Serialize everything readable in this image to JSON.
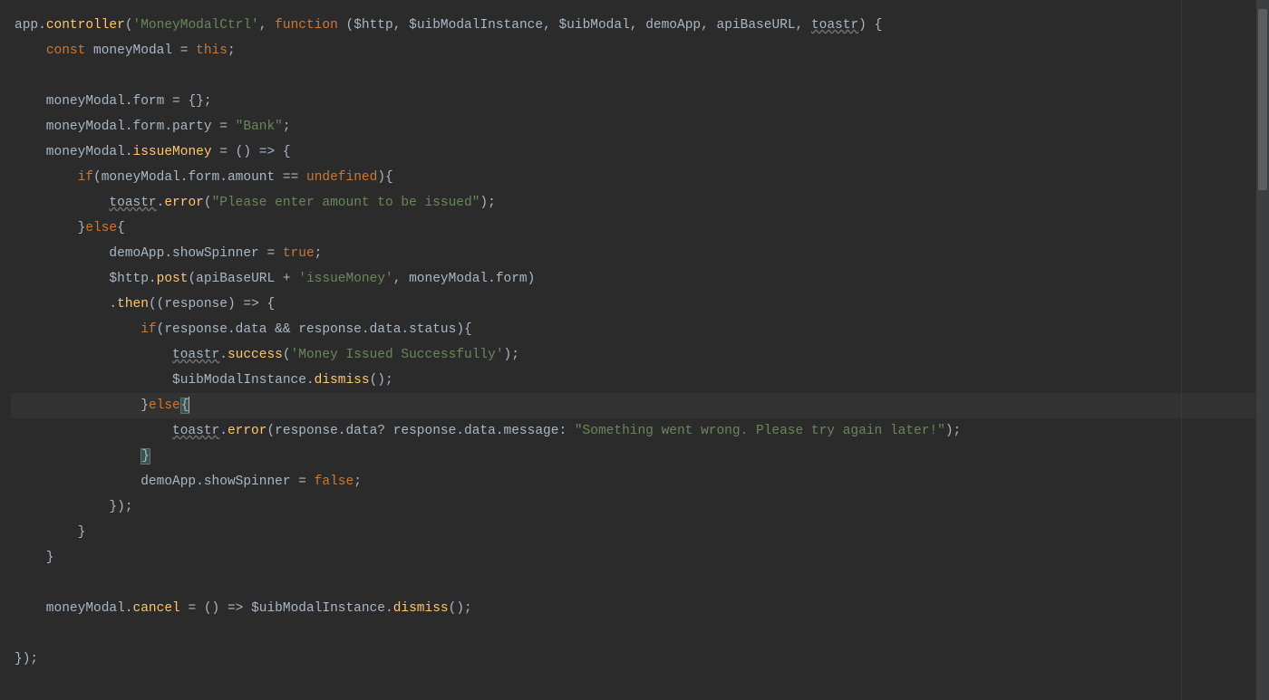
{
  "editor": {
    "lang": "javascript",
    "current_line_index": 15,
    "tokens_per_line": [
      [
        {
          "t": "app",
          "c": "c-default"
        },
        {
          "t": ".",
          "c": "c-default"
        },
        {
          "t": "controller",
          "c": "c-func"
        },
        {
          "t": "(",
          "c": "c-default"
        },
        {
          "t": "'MoneyModalCtrl'",
          "c": "c-string"
        },
        {
          "t": ", ",
          "c": "c-default"
        },
        {
          "t": "function",
          "c": "c-keyword"
        },
        {
          "t": " (",
          "c": "c-default"
        },
        {
          "t": "$http",
          "c": "c-default"
        },
        {
          "t": ", ",
          "c": "c-default"
        },
        {
          "t": "$uibModalInstance",
          "c": "c-default"
        },
        {
          "t": ", ",
          "c": "c-default"
        },
        {
          "t": "$uibModal",
          "c": "c-default"
        },
        {
          "t": ", ",
          "c": "c-default"
        },
        {
          "t": "demoApp",
          "c": "c-default"
        },
        {
          "t": ", ",
          "c": "c-default"
        },
        {
          "t": "apiBaseURL",
          "c": "c-default"
        },
        {
          "t": ", ",
          "c": "c-default"
        },
        {
          "t": "toastr",
          "c": "c-default underline-squiggle"
        },
        {
          "t": ") {",
          "c": "c-default"
        }
      ],
      [
        {
          "t": "    ",
          "c": "c-default"
        },
        {
          "t": "const",
          "c": "c-keyword"
        },
        {
          "t": " moneyModal = ",
          "c": "c-default"
        },
        {
          "t": "this",
          "c": "c-keyword"
        },
        {
          "t": ";",
          "c": "c-default"
        }
      ],
      [],
      [
        {
          "t": "    moneyModal.",
          "c": "c-default"
        },
        {
          "t": "form",
          "c": "c-default"
        },
        {
          "t": " = {};",
          "c": "c-default"
        }
      ],
      [
        {
          "t": "    moneyModal.",
          "c": "c-default"
        },
        {
          "t": "form",
          "c": "c-default"
        },
        {
          "t": ".",
          "c": "c-default"
        },
        {
          "t": "party",
          "c": "c-default"
        },
        {
          "t": " = ",
          "c": "c-default"
        },
        {
          "t": "\"Bank\"",
          "c": "c-string"
        },
        {
          "t": ";",
          "c": "c-default"
        }
      ],
      [
        {
          "t": "    moneyModal.",
          "c": "c-default"
        },
        {
          "t": "issueMoney",
          "c": "c-func"
        },
        {
          "t": " = () => {",
          "c": "c-default"
        }
      ],
      [
        {
          "t": "        ",
          "c": "c-default"
        },
        {
          "t": "if",
          "c": "c-keyword"
        },
        {
          "t": "(moneyModal.",
          "c": "c-default"
        },
        {
          "t": "form",
          "c": "c-default"
        },
        {
          "t": ".",
          "c": "c-default"
        },
        {
          "t": "amount",
          "c": "c-default"
        },
        {
          "t": " == ",
          "c": "c-default"
        },
        {
          "t": "undefined",
          "c": "c-keyword"
        },
        {
          "t": "){",
          "c": "c-default"
        }
      ],
      [
        {
          "t": "            ",
          "c": "c-default"
        },
        {
          "t": "toastr",
          "c": "c-default underline-squiggle"
        },
        {
          "t": ".",
          "c": "c-default"
        },
        {
          "t": "error",
          "c": "c-func"
        },
        {
          "t": "(",
          "c": "c-default"
        },
        {
          "t": "\"Please enter amount to be issued\"",
          "c": "c-string"
        },
        {
          "t": ");",
          "c": "c-default"
        }
      ],
      [
        {
          "t": "        }",
          "c": "c-default"
        },
        {
          "t": "else",
          "c": "c-keyword"
        },
        {
          "t": "{",
          "c": "c-default"
        }
      ],
      [
        {
          "t": "            demoApp.",
          "c": "c-default"
        },
        {
          "t": "showSpinner",
          "c": "c-default"
        },
        {
          "t": " = ",
          "c": "c-default"
        },
        {
          "t": "true",
          "c": "c-keyword"
        },
        {
          "t": ";",
          "c": "c-default"
        }
      ],
      [
        {
          "t": "            $http.",
          "c": "c-default"
        },
        {
          "t": "post",
          "c": "c-func"
        },
        {
          "t": "(apiBaseURL + ",
          "c": "c-default"
        },
        {
          "t": "'issueMoney'",
          "c": "c-string"
        },
        {
          "t": ", moneyModal.",
          "c": "c-default"
        },
        {
          "t": "form",
          "c": "c-default"
        },
        {
          "t": ")",
          "c": "c-default"
        }
      ],
      [
        {
          "t": "            .",
          "c": "c-default"
        },
        {
          "t": "then",
          "c": "c-func"
        },
        {
          "t": "((",
          "c": "c-default"
        },
        {
          "t": "response",
          "c": "c-default"
        },
        {
          "t": ") => {",
          "c": "c-default"
        }
      ],
      [
        {
          "t": "                ",
          "c": "c-default"
        },
        {
          "t": "if",
          "c": "c-keyword"
        },
        {
          "t": "(response.",
          "c": "c-default"
        },
        {
          "t": "data",
          "c": "c-default"
        },
        {
          "t": " && response.",
          "c": "c-default"
        },
        {
          "t": "data",
          "c": "c-default"
        },
        {
          "t": ".",
          "c": "c-default"
        },
        {
          "t": "status",
          "c": "c-default"
        },
        {
          "t": "){",
          "c": "c-default"
        }
      ],
      [
        {
          "t": "                    ",
          "c": "c-default"
        },
        {
          "t": "toastr",
          "c": "c-default underline-squiggle"
        },
        {
          "t": ".",
          "c": "c-default"
        },
        {
          "t": "success",
          "c": "c-func"
        },
        {
          "t": "(",
          "c": "c-default"
        },
        {
          "t": "'Money Issued Successfully'",
          "c": "c-string"
        },
        {
          "t": ");",
          "c": "c-default"
        }
      ],
      [
        {
          "t": "                    $uibModalInstance.",
          "c": "c-default"
        },
        {
          "t": "dismiss",
          "c": "c-func"
        },
        {
          "t": "();",
          "c": "c-default"
        }
      ],
      [
        {
          "t": "                }",
          "c": "c-default"
        },
        {
          "t": "else",
          "c": "c-keyword"
        },
        {
          "t": "{",
          "c": "c-default bracket-match"
        }
      ],
      [
        {
          "t": "                    ",
          "c": "c-default"
        },
        {
          "t": "toastr",
          "c": "c-default underline-squiggle"
        },
        {
          "t": ".",
          "c": "c-default"
        },
        {
          "t": "error",
          "c": "c-func"
        },
        {
          "t": "(response.",
          "c": "c-default"
        },
        {
          "t": "data",
          "c": "c-default"
        },
        {
          "t": "? response.",
          "c": "c-default"
        },
        {
          "t": "data",
          "c": "c-default"
        },
        {
          "t": ".",
          "c": "c-default"
        },
        {
          "t": "message",
          "c": "c-default"
        },
        {
          "t": ": ",
          "c": "c-default"
        },
        {
          "t": "\"Something went wrong. Please try again later!\"",
          "c": "c-string"
        },
        {
          "t": ");",
          "c": "c-default"
        }
      ],
      [
        {
          "t": "                ",
          "c": "c-default"
        },
        {
          "t": "}",
          "c": "c-default bracket-match"
        }
      ],
      [
        {
          "t": "                demoApp.",
          "c": "c-default"
        },
        {
          "t": "showSpinner",
          "c": "c-default"
        },
        {
          "t": " = ",
          "c": "c-default"
        },
        {
          "t": "false",
          "c": "c-keyword"
        },
        {
          "t": ";",
          "c": "c-default"
        }
      ],
      [
        {
          "t": "            });",
          "c": "c-default"
        }
      ],
      [
        {
          "t": "        }",
          "c": "c-default"
        }
      ],
      [
        {
          "t": "    }",
          "c": "c-default"
        }
      ],
      [],
      [
        {
          "t": "    moneyModal.",
          "c": "c-default"
        },
        {
          "t": "cancel",
          "c": "c-func"
        },
        {
          "t": " = () => $uibModalInstance.",
          "c": "c-default"
        },
        {
          "t": "dismiss",
          "c": "c-func"
        },
        {
          "t": "();",
          "c": "c-default"
        }
      ],
      [],
      [
        {
          "t": "});",
          "c": "c-default"
        }
      ]
    ]
  }
}
